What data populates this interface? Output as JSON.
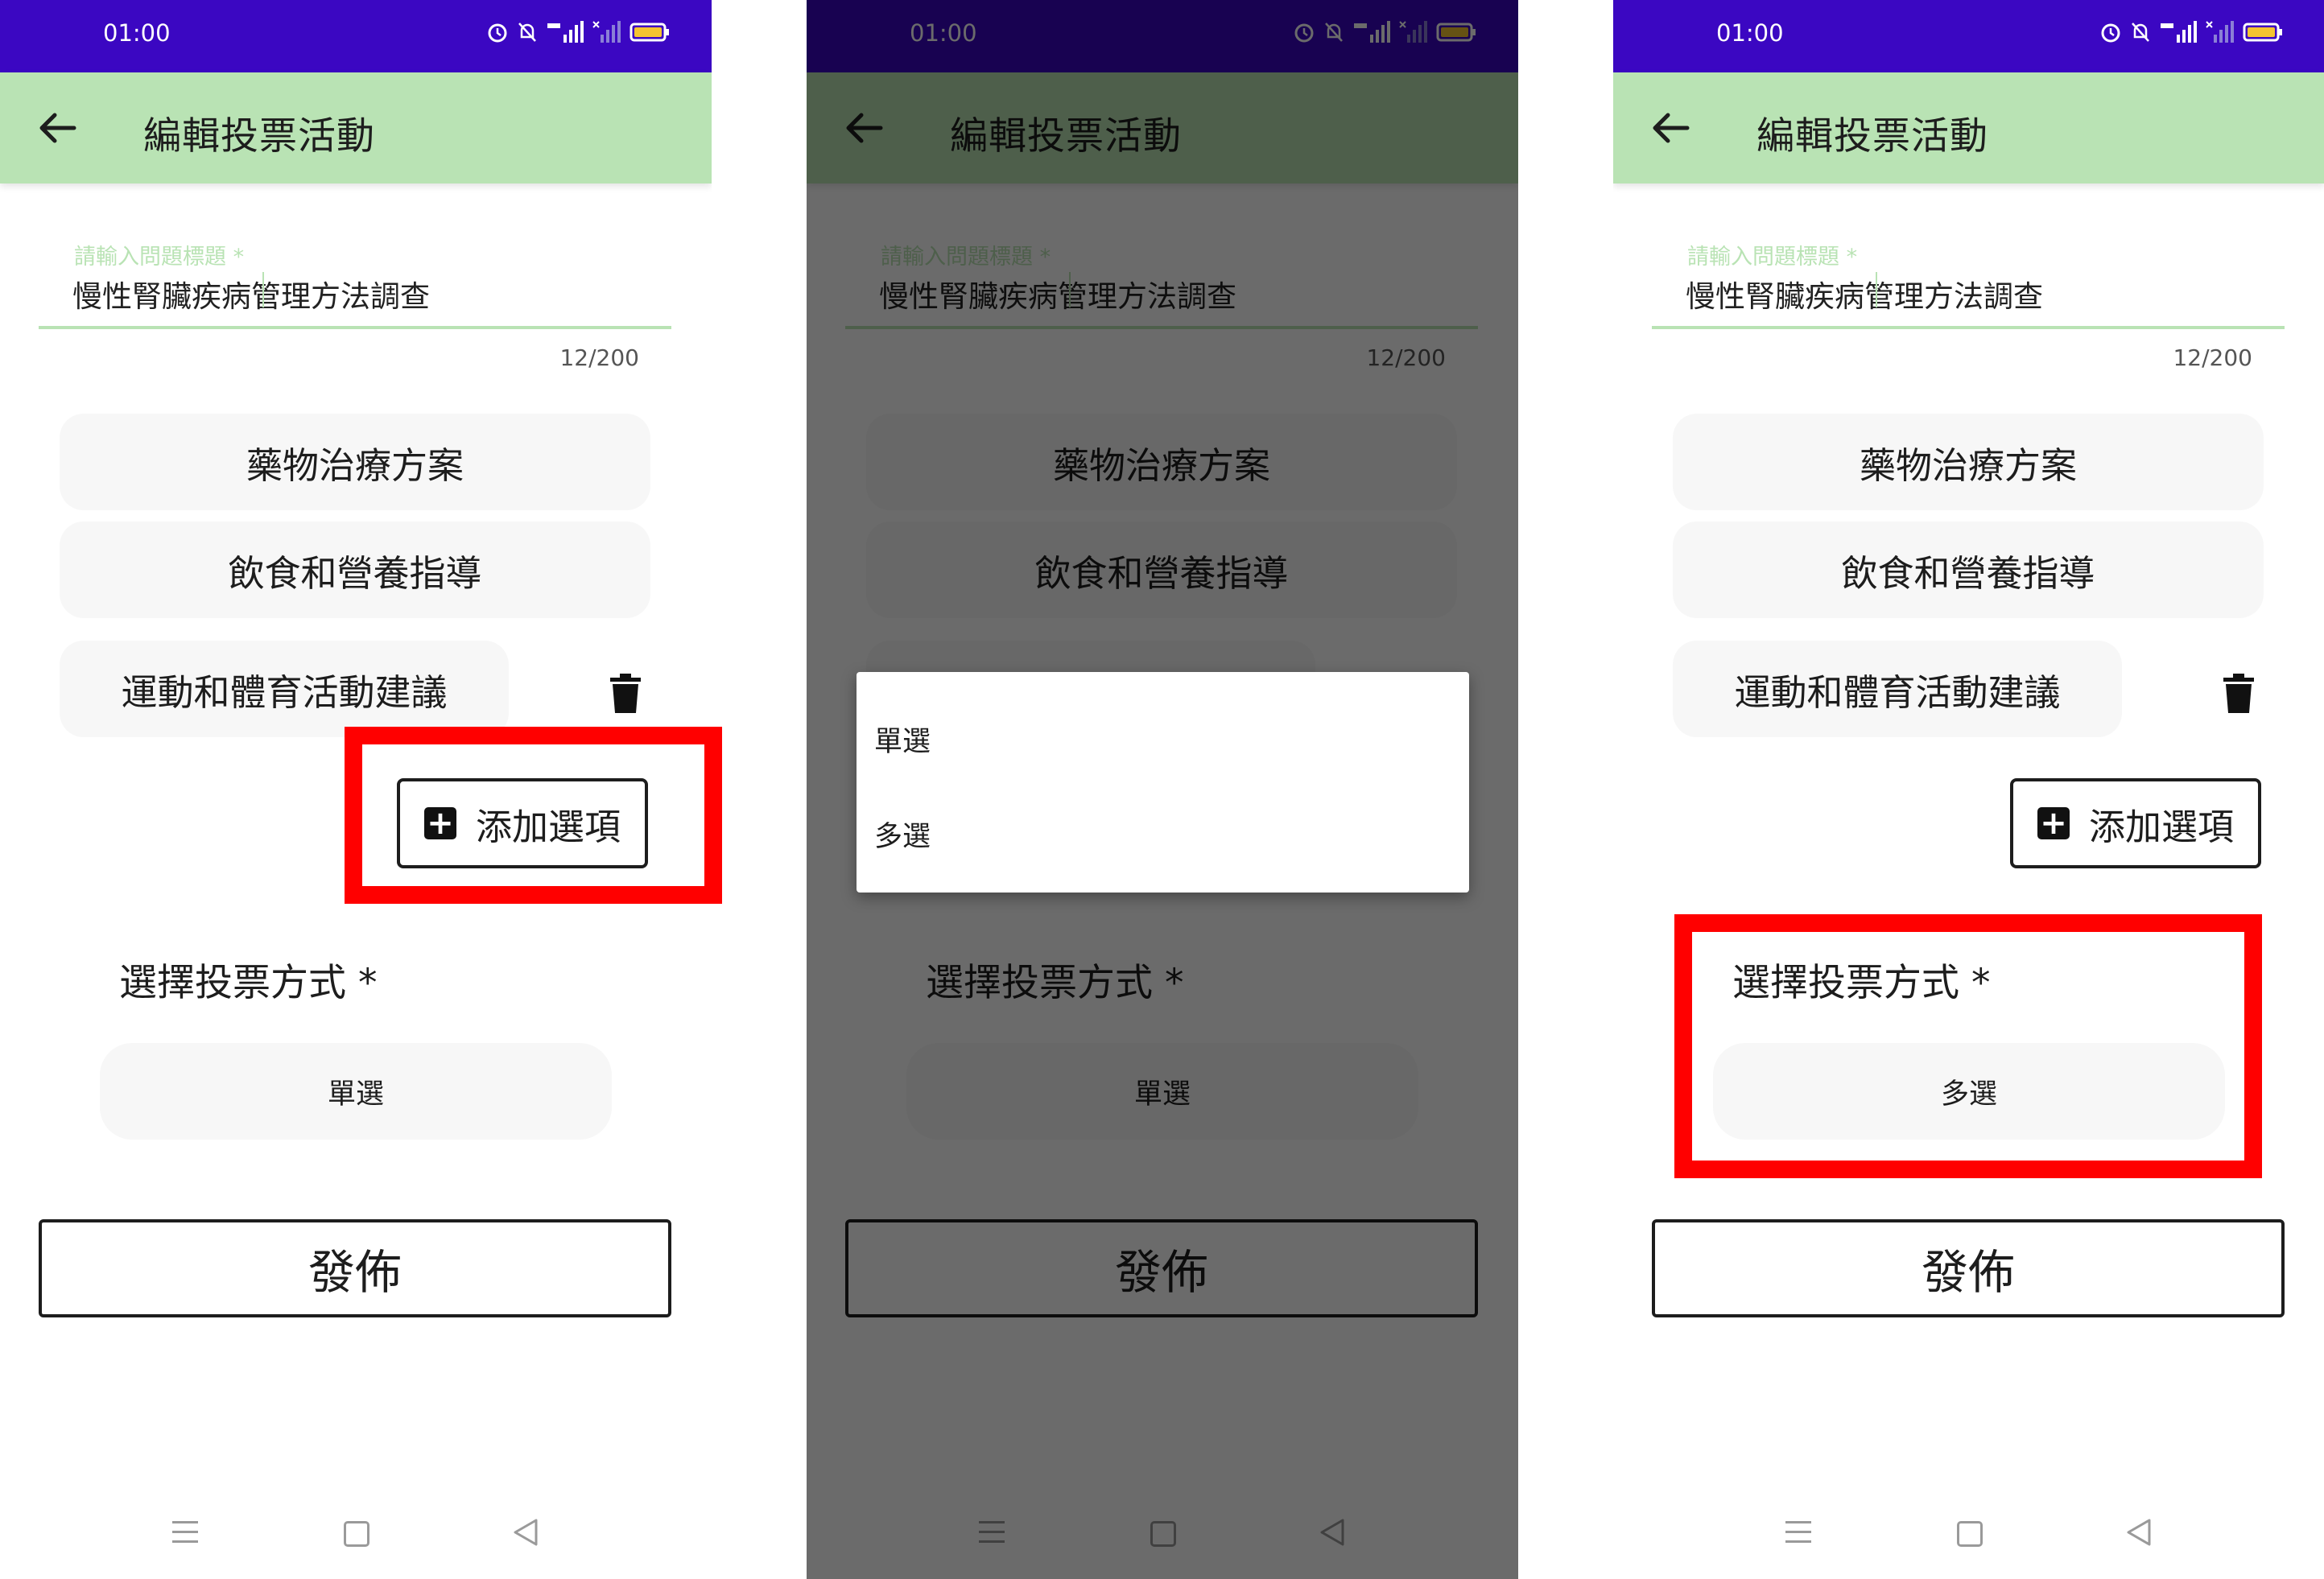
{
  "status_bar": {
    "time": "01:00"
  },
  "app_bar": {
    "title": "編輯投票活動"
  },
  "question_field": {
    "label": "請輸入問題標題 *",
    "value": "慢性腎臟疾病管理方法調查",
    "counter": "12/200"
  },
  "options": [
    "藥物治療方案",
    "飲食和營養指導",
    "運動和體育活動建議"
  ],
  "add_option_label": "添加選項",
  "vote_method": {
    "title": "選擇投票方式 *",
    "screen1_selected": "單選",
    "screen2_selected": "單選",
    "screen3_selected": "多選"
  },
  "dropdown_menu": {
    "items": [
      "單選",
      "多選"
    ]
  },
  "publish_label": "發佈",
  "colors": {
    "status_bar": "#3b07c2",
    "app_bar": "#b9e3b4",
    "highlight": "#ff0000"
  }
}
